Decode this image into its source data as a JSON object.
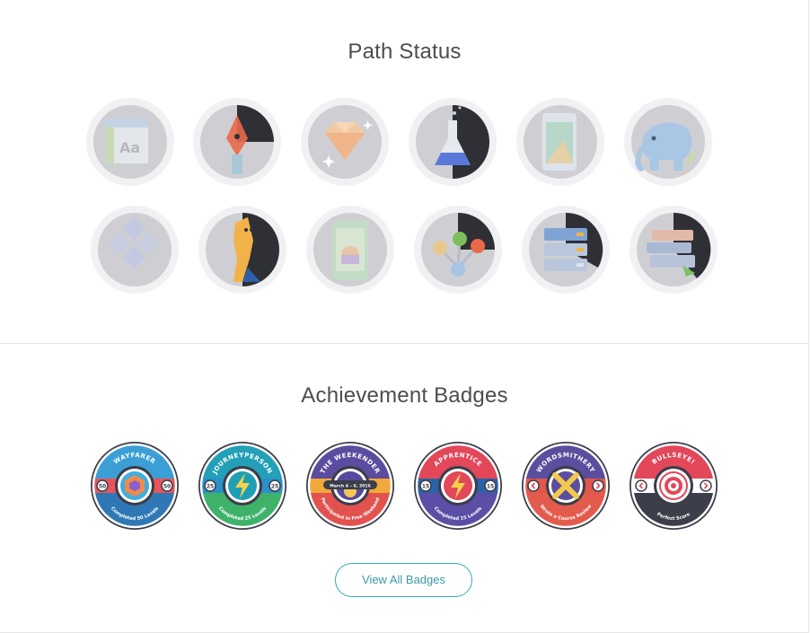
{
  "path_status": {
    "title": "Path Status",
    "icons": [
      {
        "name": "typography-icon",
        "progress": 0
      },
      {
        "name": "pen-tool-icon",
        "progress": 0.25
      },
      {
        "name": "gem-icon",
        "progress": 0
      },
      {
        "name": "flask-icon",
        "progress": 0.5
      },
      {
        "name": "mobile-design-icon",
        "progress": 0
      },
      {
        "name": "php-elephant-icon",
        "progress": 0
      },
      {
        "name": "grid-diamonds-icon",
        "progress": 0
      },
      {
        "name": "fox-mascot-icon",
        "progress": 0.5
      },
      {
        "name": "phone-app-icon",
        "progress": 0
      },
      {
        "name": "node-graph-icon",
        "progress": 0.25
      },
      {
        "name": "server-stack-icon",
        "progress": 0.4
      },
      {
        "name": "books-stack-icon",
        "progress": 0.4
      }
    ]
  },
  "achievements": {
    "title": "Achievement Badges",
    "view_all_label": "View All Badges",
    "badges": [
      {
        "name": "wayfarer-badge",
        "title": "WAYFARER",
        "subtitle": "Completed 50 Levels",
        "number": "50",
        "top": "#3b9fd6",
        "mid": "#e8555a",
        "bottom": "#2f78b5",
        "banner": "#3faee0"
      },
      {
        "name": "journeyperson-badge",
        "title": "JOURNEYPERSON",
        "subtitle": "Completed 25 Levels",
        "number": "25",
        "top": "#23a0b8",
        "mid": "#2b8fc9",
        "bottom": "#3fb26a",
        "banner": "#1f9fb5"
      },
      {
        "name": "the-weekender-badge",
        "title": "THE WEEKENDER",
        "subtitle": "Participated in Free Weekend",
        "number": "",
        "date": "March 4 – 6, 2016",
        "top": "#5b4ca0",
        "mid": "#f0a83a",
        "bottom": "#e2524f",
        "banner": "#574a9c"
      },
      {
        "name": "apprentice-badge",
        "title": "APPRENTICE",
        "subtitle": "Completed 15 Levels",
        "number": "15",
        "top": "#e2475a",
        "mid": "#2a63a8",
        "bottom": "#5a4ea6",
        "banner": "#e2475a"
      },
      {
        "name": "wordsmithery-badge",
        "title": "WORDSMITHERY",
        "subtitle": "Wrote a Course Review",
        "number": "",
        "top": "#5a4e9e",
        "mid": "#e4564a",
        "bottom": "#e35b4c",
        "banner": "#5a4e9e"
      },
      {
        "name": "bullseye-badge",
        "title": "BULLSEYE!",
        "subtitle": "Perfect Score",
        "number": "",
        "top": "#e2475a",
        "mid": "#ffffff",
        "bottom": "#3c3e4a",
        "banner": "#e2475a"
      }
    ]
  },
  "colors": {
    "ring": "#f1f1f3",
    "disc": "#cfcfd3",
    "dark_slice": "#2f2f36",
    "badge_outline": "#3b3d4a",
    "button_border": "#3aa6b9"
  }
}
